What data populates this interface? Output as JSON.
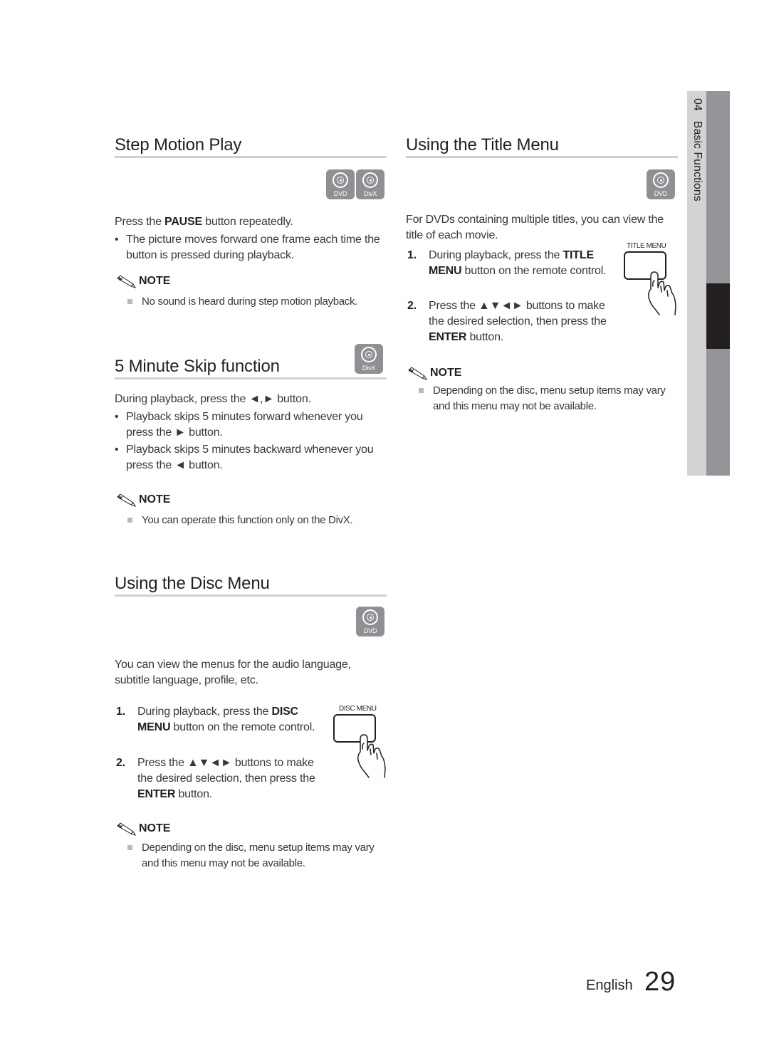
{
  "side_tab": {
    "chapter_number": "04",
    "chapter_title": "Basic Functions"
  },
  "footer": {
    "language": "English",
    "page_number": "29"
  },
  "left_column": {
    "step_motion": {
      "title": "Step Motion Play",
      "icons": [
        {
          "name": "dvd-disc-icon",
          "label": "DVD"
        },
        {
          "name": "divx-disc-icon",
          "label": "DivX"
        }
      ],
      "intro": {
        "pre": "Press the ",
        "bold": "PAUSE",
        "post": " button repeatedly."
      },
      "bullets": [
        "The picture moves forward one frame each time the button is pressed during playback."
      ],
      "note": {
        "heading": "NOTE",
        "items": [
          "No sound is heard during step motion playback."
        ]
      }
    },
    "minute_skip": {
      "title": "5 Minute Skip function",
      "icons": [
        {
          "name": "divx-disc-icon",
          "label": "DivX"
        }
      ],
      "intro": "During playback, press the ◄,► button.",
      "bullets": [
        "Playback skips 5 minutes forward whenever you press the ► button.",
        "Playback skips 5 minutes backward whenever you press the ◄ button."
      ],
      "note": {
        "heading": "NOTE",
        "items": [
          "You can operate this function only on the DivX."
        ]
      }
    },
    "disc_menu": {
      "title": "Using the Disc Menu",
      "icons": [
        {
          "name": "dvd-disc-icon",
          "label": "DVD"
        }
      ],
      "intro": "You can view the menus for the audio language, subtitle language, profile, etc.",
      "remote_button_label": "DISC MENU",
      "steps": [
        {
          "num": "1.",
          "pre": "During playback, press the ",
          "bold": "DISC MENU",
          "post": " button on the remote control."
        },
        {
          "num": "2.",
          "pre": "Press the ▲▼◄► buttons to make the desired selection, then press the ",
          "bold": "ENTER",
          "post": " button."
        }
      ],
      "note": {
        "heading": "NOTE",
        "items": [
          "Depending on the disc, menu setup items may vary and this menu may not be available."
        ]
      }
    }
  },
  "right_column": {
    "title_menu": {
      "title": "Using the Title Menu",
      "icons": [
        {
          "name": "dvd-disc-icon",
          "label": "DVD"
        }
      ],
      "intro": "For DVDs containing multiple titles, you can view the title of each movie.",
      "remote_button_label": "TITLE MENU",
      "steps": [
        {
          "num": "1.",
          "pre": "During playback, press the ",
          "bold": "TITLE MENU",
          "post": " button on the remote control."
        },
        {
          "num": "2.",
          "pre": "Press the ▲▼◄► buttons to make the desired selection, then press the ",
          "bold": "ENTER",
          "post": " button."
        }
      ],
      "note": {
        "heading": "NOTE",
        "items": [
          "Depending on the disc, menu setup items may vary and this menu may not be available."
        ]
      }
    }
  }
}
